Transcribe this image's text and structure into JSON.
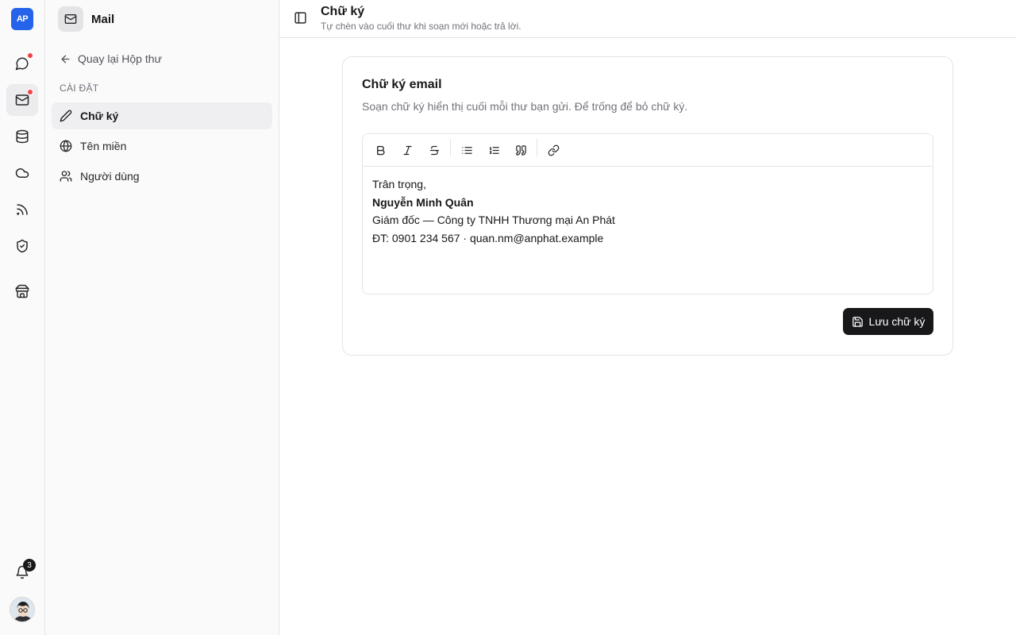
{
  "rail": {
    "logo": "AP",
    "notification_count": "3"
  },
  "sidebar": {
    "app_name": "Mail",
    "back_label": "Quay lại Hộp thư",
    "section_label": "CÀI ĐẶT",
    "items": [
      {
        "label": "Chữ ký",
        "icon": "pencil-icon",
        "active": true
      },
      {
        "label": "Tên miền",
        "icon": "globe-icon",
        "active": false
      },
      {
        "label": "Người dùng",
        "icon": "users-icon",
        "active": false
      }
    ]
  },
  "header": {
    "title": "Chữ ký",
    "subtitle": "Tự chèn vào cuối thư khi soạn mới hoặc trả lời."
  },
  "card": {
    "title": "Chữ ký email",
    "description": "Soạn chữ ký hiển thị cuối mỗi thư bạn gửi. Để trống để bỏ chữ ký.",
    "signature_lines": [
      "Trân trọng,",
      "Nguyễn Minh Quân",
      "Giám đốc — Công ty TNHH Thương mại An Phát",
      "ĐT: 0901 234 567 · quan.nm@anphat.example"
    ],
    "save_label": "Lưu chữ ký"
  },
  "colors": {
    "accent": "#18181b",
    "logo_bg": "#2563eb",
    "unread_dot": "#ef4444",
    "muted_text": "#71717a",
    "border": "#e4e4e7"
  }
}
